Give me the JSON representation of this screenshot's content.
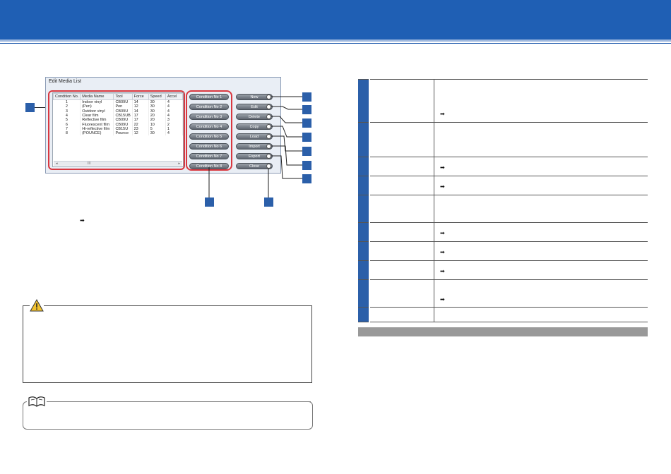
{
  "dialog": {
    "title": "Edit Media List",
    "columns": [
      "Condition No.",
      "Media Name",
      "Tool",
      "Force",
      "Speed",
      "Accel"
    ],
    "rows": [
      [
        "1",
        "Indoor vinyl",
        "CB09U",
        "14",
        "30",
        "4"
      ],
      [
        "2",
        "(Pen)",
        "Pen",
        "12",
        "30",
        "4"
      ],
      [
        "3",
        "Outdoor vinyl",
        "CB09U",
        "14",
        "30",
        "4"
      ],
      [
        "4",
        "Clear film",
        "CB15UB",
        "17",
        "20",
        "4"
      ],
      [
        "5",
        "Reflective film",
        "CB09U",
        "17",
        "20",
        "3"
      ],
      [
        "6",
        "Fluorescent film",
        "CB09U",
        "22",
        "10",
        "2"
      ],
      [
        "7",
        "Hi-reflective film",
        "CB15U",
        "23",
        "5",
        "1"
      ],
      [
        "8",
        "(POUNCE)",
        "Pounce",
        "12",
        "30",
        "4"
      ]
    ],
    "scroll_glyph": "III",
    "condition_buttons": [
      "Condition No 1",
      "Condition No 2",
      "Condition No 3",
      "Condition No 4",
      "Condition No 5",
      "Condition No 6",
      "Condition No 7",
      "Condition No 8"
    ],
    "action_buttons": [
      "New",
      "Edit",
      "Delete",
      "Copy",
      "Load",
      "Import",
      "Export",
      "Close"
    ]
  },
  "colors": {
    "header_blue": "#1f5fb4",
    "callout_blue": "#2b5fa9",
    "highlight_red": "#d9373f",
    "bar_gray": "#999999"
  },
  "icons": {
    "arrow": "➡",
    "caution": "warning-triangle-icon",
    "note": "open-book-icon"
  }
}
